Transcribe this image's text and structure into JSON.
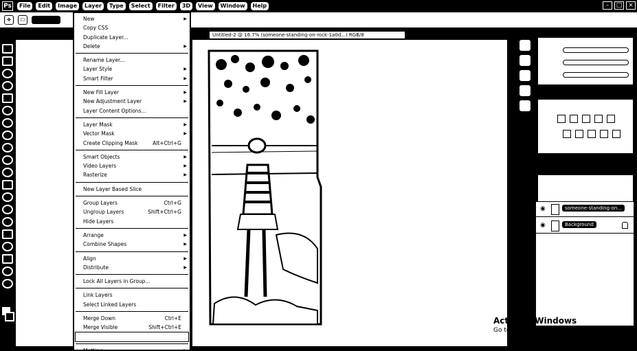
{
  "app": {
    "logo_text": "Ps"
  },
  "menubar": {
    "items": [
      "File",
      "Edit",
      "Image",
      "Layer",
      "Type",
      "Select",
      "Filter",
      "3D",
      "View",
      "Window",
      "Help"
    ]
  },
  "document": {
    "tab_label": "Untitled-2 @ 16.7% (someone-standing-on-rock-1a0d...) RGB/8"
  },
  "layer_menu": {
    "items": [
      {
        "label": "New",
        "arrow": true
      },
      {
        "label": "Copy CSS"
      },
      {
        "label": "Duplicate Layer..."
      },
      {
        "label": "Delete",
        "arrow": true
      },
      {
        "sep": true
      },
      {
        "label": "Rename Layer..."
      },
      {
        "label": "Layer Style",
        "arrow": true
      },
      {
        "label": "Smart Filter",
        "arrow": true
      },
      {
        "sep": true
      },
      {
        "label": "New Fill Layer",
        "arrow": true
      },
      {
        "label": "New Adjustment Layer",
        "arrow": true
      },
      {
        "label": "Layer Content Options..."
      },
      {
        "sep": true
      },
      {
        "label": "Layer Mask",
        "arrow": true
      },
      {
        "label": "Vector Mask",
        "arrow": true
      },
      {
        "label": "Create Clipping Mask",
        "shortcut": "Alt+Ctrl+G"
      },
      {
        "sep": true
      },
      {
        "label": "Smart Objects",
        "arrow": true
      },
      {
        "label": "Video Layers",
        "arrow": true
      },
      {
        "label": "Rasterize",
        "arrow": true
      },
      {
        "sep": true
      },
      {
        "label": "New Layer Based Slice"
      },
      {
        "sep": true
      },
      {
        "label": "Group Layers",
        "shortcut": "Ctrl+G"
      },
      {
        "label": "Ungroup Layers",
        "shortcut": "Shift+Ctrl+G"
      },
      {
        "label": "Hide Layers"
      },
      {
        "sep": true
      },
      {
        "label": "Arrange",
        "arrow": true
      },
      {
        "label": "Combine Shapes",
        "arrow": true
      },
      {
        "sep": true
      },
      {
        "label": "Align",
        "arrow": true
      },
      {
        "label": "Distribute",
        "arrow": true
      },
      {
        "sep": true
      },
      {
        "label": "Lock All Layers in Group..."
      },
      {
        "sep": true
      },
      {
        "label": "Link Layers"
      },
      {
        "label": "Select Linked Layers"
      },
      {
        "sep": true
      },
      {
        "label": "Merge Down",
        "shortcut": "Ctrl+E"
      },
      {
        "label": "Merge Visible",
        "shortcut": "Shift+Ctrl+E"
      },
      {
        "label": "",
        "highlight": true
      },
      {
        "sep": true
      },
      {
        "label": "Matting",
        "arrow": true
      }
    ]
  },
  "layers_panel": {
    "rows": [
      {
        "name": "someone-standing-on...",
        "visible": true
      },
      {
        "name": "Background",
        "visible": true,
        "locked": true
      }
    ]
  },
  "watermark": {
    "title": "Activate Windows",
    "subtitle": "Go to Settings to activate Windows."
  }
}
